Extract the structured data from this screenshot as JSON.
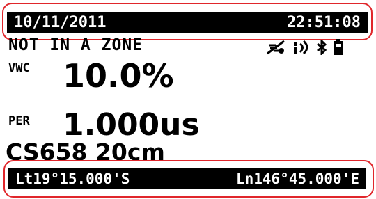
{
  "header": {
    "date": "10/11/2011",
    "time": "22:51:08"
  },
  "zone_status": "NOT IN A ZONE",
  "status_icons": [
    "gps-off-icon",
    "signal-icon",
    "bluetooth-icon",
    "battery-icon"
  ],
  "vwc": {
    "label": "VWC",
    "value": "10.0%"
  },
  "per": {
    "label": "PER",
    "value": "1.000us"
  },
  "sensor": "CS658 20cm",
  "footer": {
    "latitude": "Lt19°15.000'S",
    "longitude": "Ln146°45.000'E"
  },
  "colors": {
    "highlight": "#e0262b",
    "bar": "#000000"
  }
}
